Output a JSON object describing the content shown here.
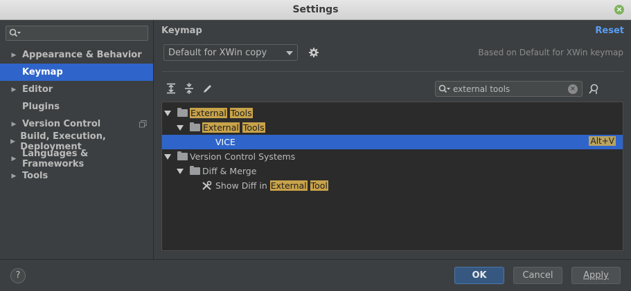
{
  "window": {
    "title": "Settings"
  },
  "sidebar": {
    "search_placeholder": "",
    "items": [
      {
        "label": "Appearance & Behavior",
        "expandable": true
      },
      {
        "label": "Keymap",
        "expandable": false,
        "selected": true
      },
      {
        "label": "Editor",
        "expandable": true
      },
      {
        "label": "Plugins",
        "expandable": false
      },
      {
        "label": "Version Control",
        "expandable": true
      },
      {
        "label": "Build, Execution, Deployment",
        "expandable": true
      },
      {
        "label": "Languages & Frameworks",
        "expandable": true
      },
      {
        "label": "Tools",
        "expandable": true
      }
    ]
  },
  "main": {
    "header": "Keymap",
    "reset_label": "Reset",
    "scheme_value": "Default for XWin copy",
    "based_on": "Based on Default for XWin keymap",
    "filter_value": "external tools",
    "tree": [
      {
        "pre": "",
        "hl1": "External",
        "hl2": "Tools",
        "post": ""
      },
      {
        "pre": "",
        "hl1": "External",
        "hl2": "Tools",
        "post": ""
      },
      {
        "label": "VICE",
        "shortcut": "Alt+V"
      },
      {
        "label": "Version Control Systems"
      },
      {
        "label": "Diff & Merge"
      },
      {
        "pre": "Show Diff in ",
        "hl1": "External",
        "hl2": "Tool",
        "post": ""
      }
    ]
  },
  "footer": {
    "help": "?",
    "ok": "OK",
    "cancel": "Cancel",
    "apply": "Apply"
  },
  "colors": {
    "accent": "#2f65ca",
    "highlight": "#c9a34a",
    "link": "#589df6"
  }
}
